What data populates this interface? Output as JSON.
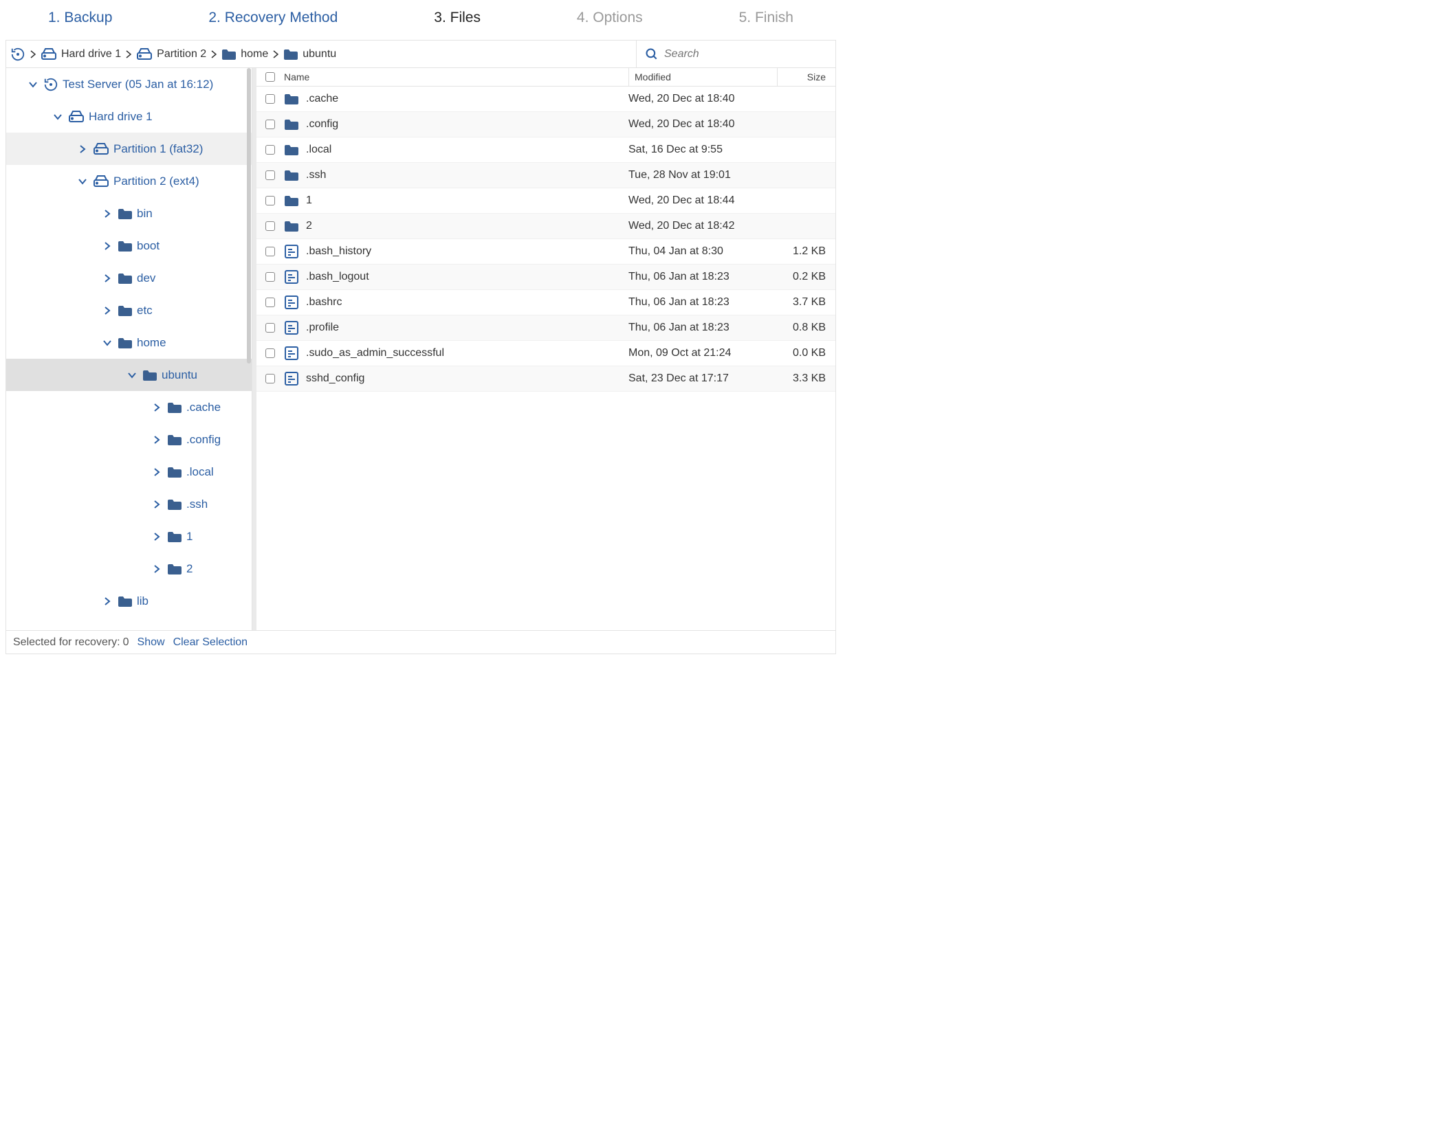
{
  "steps": [
    {
      "label": "1. Backup",
      "state": "link"
    },
    {
      "label": "2. Recovery Method",
      "state": "link"
    },
    {
      "label": "3. Files",
      "state": "active"
    },
    {
      "label": "4. Options",
      "state": "disabled"
    },
    {
      "label": "5. Finish",
      "state": "disabled"
    }
  ],
  "breadcrumb": [
    {
      "icon": "drive",
      "label": "Hard drive 1"
    },
    {
      "icon": "drive",
      "label": "Partition 2"
    },
    {
      "icon": "folder",
      "label": "home"
    },
    {
      "icon": "folder",
      "label": "ubuntu"
    }
  ],
  "search": {
    "placeholder": "Search"
  },
  "tree": {
    "root": {
      "label": "Test Server (05 Jan at 16:12)"
    },
    "drive": {
      "label": "Hard drive 1"
    },
    "part1": {
      "label": "Partition 1 (fat32)"
    },
    "part2": {
      "label": "Partition 2 (ext4)"
    },
    "dirs_level4": [
      "bin",
      "boot",
      "dev",
      "etc",
      "home"
    ],
    "home_child": "ubuntu",
    "ubuntu_children": [
      ".cache",
      ".config",
      ".local",
      ".ssh",
      "1",
      "2"
    ],
    "after_home": "lib"
  },
  "table": {
    "headers": {
      "name": "Name",
      "modified": "Modified",
      "size": "Size"
    }
  },
  "files": [
    {
      "type": "folder",
      "name": ".cache",
      "modified": "Wed, 20 Dec at 18:40",
      "size": ""
    },
    {
      "type": "folder",
      "name": ".config",
      "modified": "Wed, 20 Dec at 18:40",
      "size": ""
    },
    {
      "type": "folder",
      "name": ".local",
      "modified": "Sat, 16 Dec at 9:55",
      "size": ""
    },
    {
      "type": "folder",
      "name": ".ssh",
      "modified": "Tue, 28 Nov at 19:01",
      "size": ""
    },
    {
      "type": "folder",
      "name": "1",
      "modified": "Wed, 20 Dec at 18:44",
      "size": ""
    },
    {
      "type": "folder",
      "name": "2",
      "modified": "Wed, 20 Dec at 18:42",
      "size": ""
    },
    {
      "type": "file",
      "name": ".bash_history",
      "modified": "Thu, 04 Jan at 8:30",
      "size": "1.2 KB"
    },
    {
      "type": "file",
      "name": ".bash_logout",
      "modified": "Thu, 06 Jan at 18:23",
      "size": "0.2 KB"
    },
    {
      "type": "file",
      "name": ".bashrc",
      "modified": "Thu, 06 Jan at 18:23",
      "size": "3.7 KB"
    },
    {
      "type": "file",
      "name": ".profile",
      "modified": "Thu, 06 Jan at 18:23",
      "size": "0.8 KB"
    },
    {
      "type": "file",
      "name": ".sudo_as_admin_successful",
      "modified": "Mon, 09 Oct at 21:24",
      "size": "0.0 KB"
    },
    {
      "type": "file",
      "name": "sshd_config",
      "modified": "Sat, 23 Dec at 17:17",
      "size": "3.3 KB"
    }
  ],
  "footer": {
    "selected_label": "Selected for recovery:",
    "selected_count": "0",
    "show": "Show",
    "clear": "Clear Selection"
  }
}
